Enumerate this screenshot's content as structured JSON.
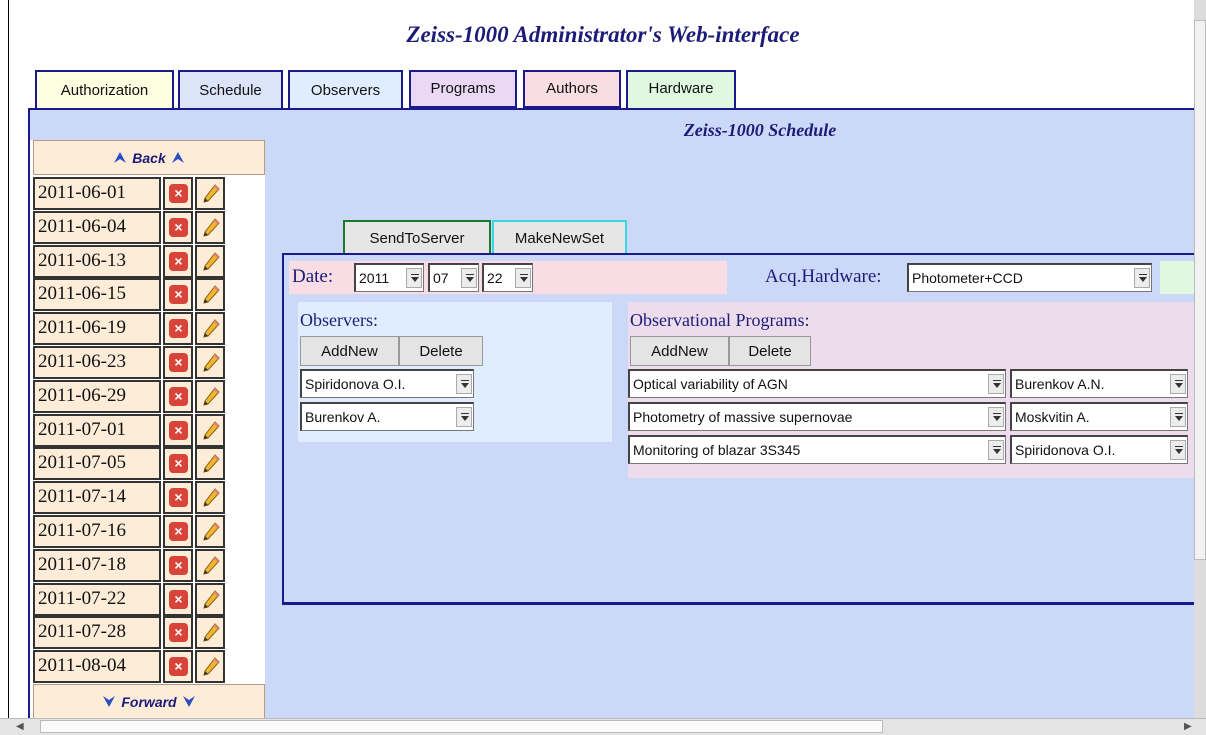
{
  "app_title": "Zeiss-1000 Administrator's Web-interface",
  "tabs": [
    {
      "label": "Authorization",
      "bg": "#fefee0"
    },
    {
      "label": "Schedule",
      "bg": "#dce4fa"
    },
    {
      "label": "Observers",
      "bg": "#e0ecff"
    },
    {
      "label": "Programs",
      "bg": "#ead8f4"
    },
    {
      "label": "Authors",
      "bg": "#f8dde4"
    },
    {
      "label": "Hardware",
      "bg": "#e0f8e0"
    }
  ],
  "schedule": {
    "title": "Zeiss-1000 Schedule",
    "back_label": "Back",
    "forward_label": "Forward",
    "dates": [
      "2011-06-01",
      "2011-06-04",
      "2011-06-13",
      "2011-06-15",
      "2011-06-19",
      "2011-06-23",
      "2011-06-29",
      "2011-07-01",
      "2011-07-05",
      "2011-07-14",
      "2011-07-16",
      "2011-07-18",
      "2011-07-22",
      "2011-07-28",
      "2011-08-04"
    ]
  },
  "actions": {
    "send_label": "SendToServer",
    "new_set_label": "MakeNewSet"
  },
  "form": {
    "date_label": "Date:",
    "year": "2011",
    "month": "07",
    "day": "22",
    "acq_label": "Acq.Hardware:",
    "acq_value": "Photometer+CCD"
  },
  "observers": {
    "label": "Observers:",
    "add_label": "AddNew",
    "delete_label": "Delete",
    "items": [
      "Spiridonova  O.I.",
      "Burenkov  A."
    ]
  },
  "programs": {
    "label": "Observational Programs:",
    "add_label": "AddNew",
    "delete_label": "Delete",
    "items": [
      {
        "name": "Optical  variability   of AGN",
        "author": "Burenkov  A.N."
      },
      {
        "name": "Photometry  of massive  supernovae",
        "author": "Moskvitin  A."
      },
      {
        "name": "Monitoring   of blazar 3S345",
        "author": "Spiridonova   O.I."
      }
    ]
  },
  "colors": {
    "accent": "#1a1a8c",
    "title_text": "#1c1c78",
    "panel_bg": "#ccd8f8"
  }
}
